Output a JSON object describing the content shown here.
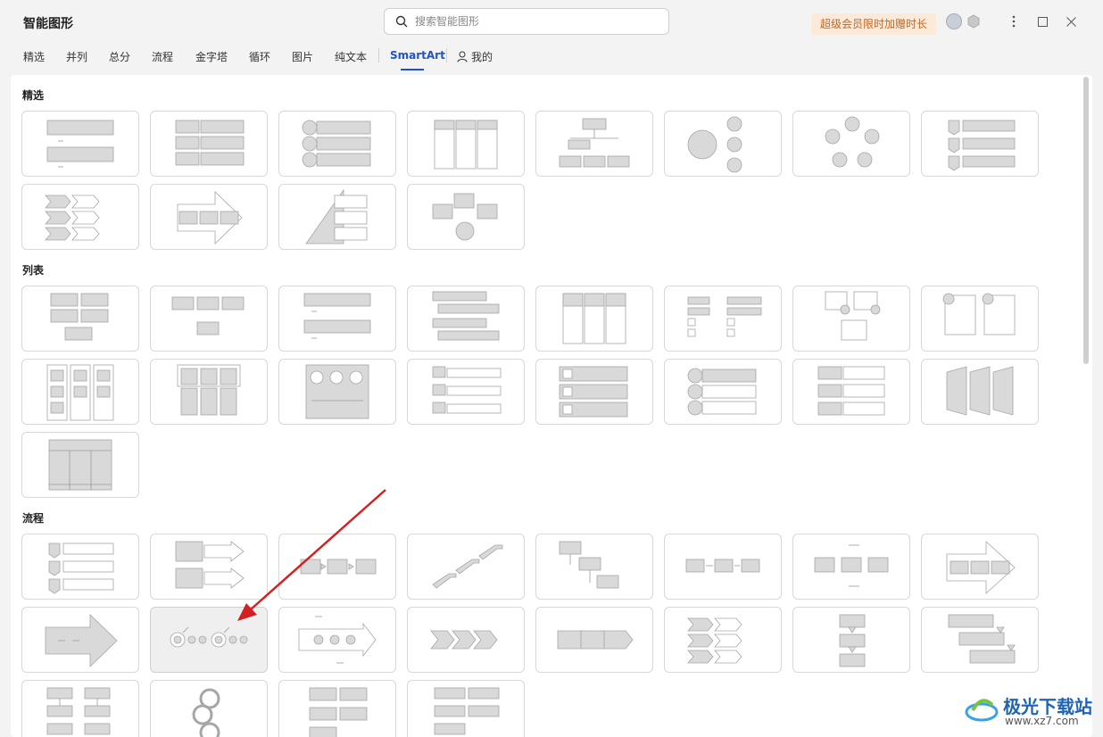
{
  "app": {
    "title": "智能图形"
  },
  "search": {
    "placeholder": "搜索智能图形",
    "value": ""
  },
  "header": {
    "vip_label": "超级会员限时加赠时长"
  },
  "tabs": [
    {
      "label": "精选"
    },
    {
      "label": "并列"
    },
    {
      "label": "总分"
    },
    {
      "label": "流程"
    },
    {
      "label": "金字塔"
    },
    {
      "label": "循环"
    },
    {
      "label": "图片"
    },
    {
      "label": "纯文本"
    },
    {
      "label": "SmartArt",
      "active": true
    },
    {
      "label": "我的"
    }
  ],
  "sections": [
    {
      "title": "精选",
      "count": 12
    },
    {
      "title": "列表",
      "count": 17
    },
    {
      "title": "流程",
      "count": 20
    }
  ],
  "selected_template": {
    "section": "流程",
    "index": 9
  },
  "watermark": {
    "name": "极光下载站",
    "url": "www.xz7.com"
  },
  "colors": {
    "accent": "#2253c6",
    "vip_bg": "#fde9d8",
    "vip_text": "#b86a2c",
    "shape_fill": "#d9d9d9",
    "shape_stroke": "#a6a6a6",
    "annotation_arrow": "#d42020"
  }
}
